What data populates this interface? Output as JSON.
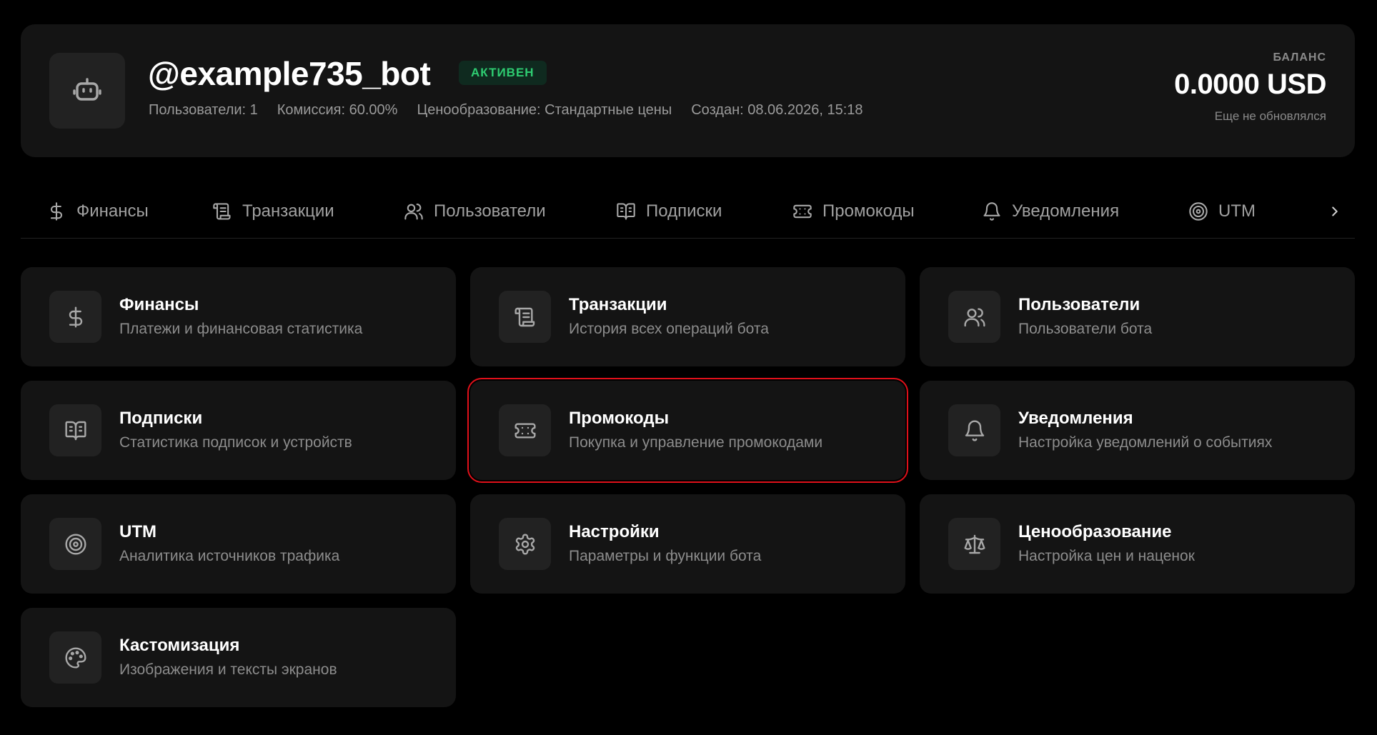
{
  "header": {
    "title": "@example735_bot",
    "status": "АКТИВЕН",
    "meta": {
      "users": "Пользователи: 1",
      "commission": "Комиссия: 60.00%",
      "pricing": "Ценообразование: Стандартные цены",
      "created": "Создан: 08.06.2026, 15:18"
    },
    "balance": {
      "label": "БАЛАНС",
      "value": "0.0000 USD",
      "note": "Еще не обновлялся"
    }
  },
  "tabs": [
    {
      "label": "Финансы",
      "icon": "dollar-icon"
    },
    {
      "label": "Транзакции",
      "icon": "scroll-icon"
    },
    {
      "label": "Пользователи",
      "icon": "users-icon"
    },
    {
      "label": "Подписки",
      "icon": "book-icon"
    },
    {
      "label": "Промокоды",
      "icon": "ticket-icon"
    },
    {
      "label": "Уведомления",
      "icon": "bell-icon"
    },
    {
      "label": "UTM",
      "icon": "target-icon"
    }
  ],
  "cards": [
    {
      "title": "Финансы",
      "desc": "Платежи и финансовая статистика",
      "icon": "dollar-icon"
    },
    {
      "title": "Транзакции",
      "desc": "История всех операций бота",
      "icon": "scroll-icon"
    },
    {
      "title": "Пользователи",
      "desc": "Пользователи бота",
      "icon": "users-icon"
    },
    {
      "title": "Подписки",
      "desc": "Статистика подписок и устройств",
      "icon": "book-icon"
    },
    {
      "title": "Промокоды",
      "desc": "Покупка и управление промокодами",
      "icon": "ticket-icon",
      "highlighted": true
    },
    {
      "title": "Уведомления",
      "desc": "Настройка уведомлений о событиях",
      "icon": "bell-icon"
    },
    {
      "title": "UTM",
      "desc": "Аналитика источников трафика",
      "icon": "target-icon"
    },
    {
      "title": "Настройки",
      "desc": "Параметры и функции бота",
      "icon": "gear-icon"
    },
    {
      "title": "Ценообразование",
      "desc": "Настройка цен и наценок",
      "icon": "scale-icon"
    },
    {
      "title": "Кастомизация",
      "desc": "Изображения и тексты экранов",
      "icon": "palette-icon"
    }
  ],
  "colors": {
    "background": "#000000",
    "card": "#141414",
    "status_green": "#2ecc71",
    "highlight_red": "#e0101a"
  }
}
